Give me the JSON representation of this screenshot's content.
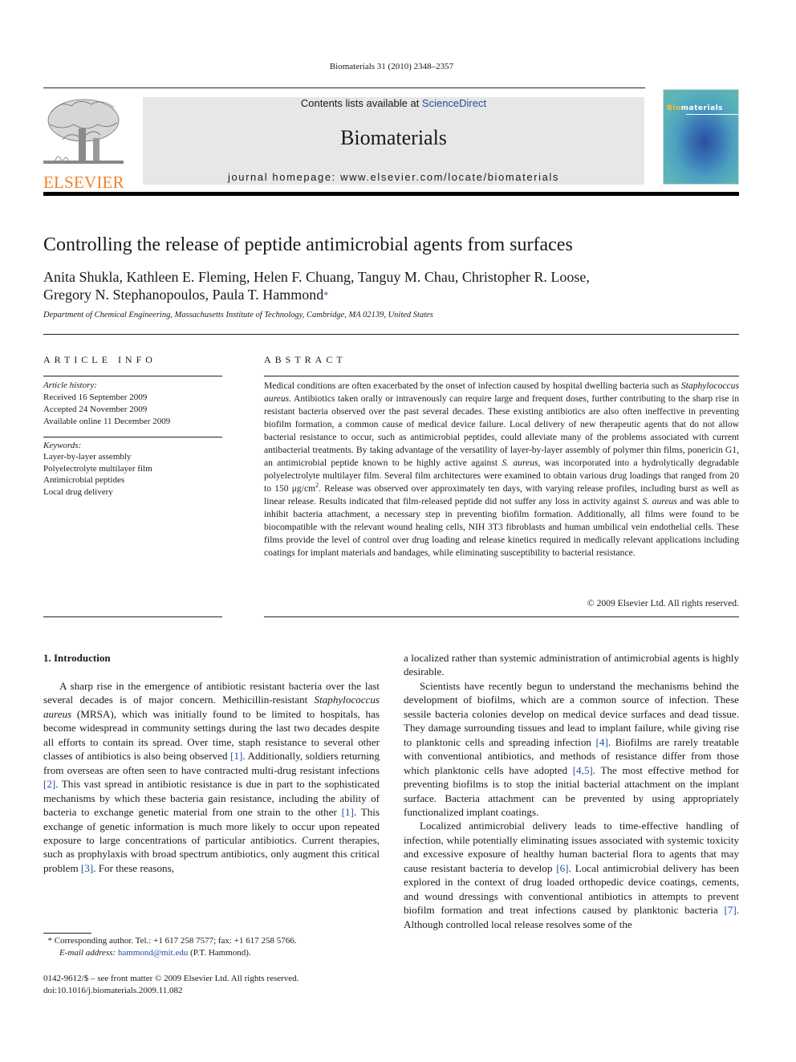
{
  "header": {
    "journal_ref": "Biomaterials 31 (2010) 2348–2357",
    "contents_prefix": "Contents lists available at ",
    "contents_link": "ScienceDirect",
    "journal_name": "Biomaterials",
    "homepage": "journal homepage: www.elsevier.com/locate/biomaterials",
    "publisher_logo_text": "ELSEVIER",
    "cover": {
      "title_highlight": "Bio",
      "title_rest": "materials",
      "highlight_color": "#f2c12e"
    },
    "colors": {
      "publisher_orange": "#f0822a",
      "link_blue": "#1f4ea3",
      "banner_gray": "#e7e7e7"
    }
  },
  "article": {
    "title": "Controlling the release of peptide antimicrobial agents from surfaces",
    "authors_line1": "Anita Shukla, Kathleen E. Fleming, Helen F. Chuang, Tanguy M. Chau, Christopher R. Loose,",
    "authors_line2": "Gregory N. Stephanopoulos, Paula T. Hammond",
    "corresponding_mark": "*",
    "affiliation": "Department of Chemical Engineering, Massachusetts Institute of Technology, Cambridge, MA 02139, United States"
  },
  "article_info": {
    "heading": "ARTICLE INFO",
    "history_label": "Article history:",
    "history": [
      "Received 16 September 2009",
      "Accepted 24 November 2009",
      "Available online 11 December 2009"
    ],
    "keywords_label": "Keywords:",
    "keywords": [
      "Layer-by-layer assembly",
      "Polyelectrolyte multilayer film",
      "Antimicrobial peptides",
      "Local drug delivery"
    ]
  },
  "abstract": {
    "heading": "ABSTRACT",
    "p1": "Medical conditions are often exacerbated by the onset of infection caused by hospital dwelling bacteria such as ",
    "i1": "Staphylococcus aureus",
    "p2": ". Antibiotics taken orally or intravenously can require large and frequent doses, further contributing to the sharp rise in resistant bacteria observed over the past several decades. These existing antibiotics are also often ineffective in preventing biofilm formation, a common cause of medical device failure. Local delivery of new therapeutic agents that do not allow bacterial resistance to occur, such as antimicrobial peptides, could alleviate many of the problems associated with current antibacterial treatments. By taking advantage of the versatility of layer-by-layer assembly of polymer thin films, ponericin G1, an antimicrobial peptide known to be highly active against ",
    "i2": "S. aureus",
    "p3": ", was incorporated into a hydrolytically degradable polyelectrolyte multilayer film. Several film architectures were examined to obtain various drug loadings that ranged from 20 to 150 μg/cm",
    "sup": "2",
    "p4": ". Release was observed over approximately ten days, with varying release profiles, including burst as well as linear release. Results indicated that film-released peptide did not suffer any loss in activity against ",
    "i3": "S. aureus",
    "p5": " and was able to inhibit bacteria attachment, a necessary step in preventing biofilm formation. Additionally, all films were found to be biocompatible with the relevant wound healing cells, NIH 3T3 fibroblasts and human umbilical vein endothelial cells. These films provide the level of control over drug loading and release kinetics required in medically relevant applications including coatings for implant materials and bandages, while eliminating susceptibility to bacterial resistance.",
    "copyright": "© 2009 Elsevier Ltd. All rights reserved."
  },
  "intro": {
    "heading": "1.  Introduction",
    "left": {
      "a": "A sharp rise in the emergence of antibiotic resistant bacteria over the last several decades is of major concern. Methicillin-resistant ",
      "a_it": "Staphylococcus aureus",
      "b": " (MRSA), which was initially found to be limited to hospitals, has become widespread in community settings during the last two decades despite all efforts to contain its spread. Over time, staph resistance to several other classes of antibiotics is also being observed ",
      "r1": "[1]",
      "c": ". Additionally, soldiers returning from overseas are often seen to have contracted multi-drug resistant infections ",
      "r2": "[2]",
      "d": ". This vast spread in antibiotic resistance is due in part to the sophisticated mechanisms by which these bacteria gain resistance, including the ability of bacteria to exchange genetic material from one strain to the other ",
      "r3": "[1]",
      "e": ". This exchange of genetic information is much more likely to occur upon repeated exposure to large concentrations of particular antibiotics. Current therapies, such as prophylaxis with broad spectrum antibiotics, only augment this critical problem ",
      "r4": "[3]",
      "f": ". For these reasons,"
    },
    "right": {
      "cont": "a localized rather than systemic administration of antimicrobial agents is highly desirable.",
      "p2a": "Scientists have recently begun to understand the mechanisms behind the development of biofilms, which are a common source of infection. These sessile bacteria colonies develop on medical device surfaces and dead tissue. They damage surrounding tissues and lead to implant failure, while giving rise to planktonic cells and spreading infection ",
      "r4": "[4]",
      "p2b": ". Biofilms are rarely treatable with conventional antibiotics, and methods of resistance differ from those which planktonic cells have adopted ",
      "r45": "[4,5]",
      "p2c": ". The most effective method for preventing biofilms is to stop the initial bacterial attachment on the implant surface. Bacteria attachment can be prevented by using appropriately functionalized implant coatings.",
      "p3a": "Localized antimicrobial delivery leads to time-effective handling of infection, while potentially eliminating issues associated with systemic toxicity and excessive exposure of healthy human bacterial flora to agents that may cause resistant bacteria to develop ",
      "r6": "[6]",
      "p3b": ". Local antimicrobial delivery has been explored in the context of drug loaded orthopedic device coatings, cements, and wound dressings with conventional antibiotics in attempts to prevent biofilm formation and treat infections caused by planktonic bacteria ",
      "r7": "[7]",
      "p3c": ". Although controlled local release resolves some of the"
    }
  },
  "footnote": {
    "mark": "*",
    "line1": " Corresponding author. Tel.: +1 617 258 7577; fax: +1 617 258 5766.",
    "email_label": "E-mail address: ",
    "email": "hammond@mit.edu",
    "email_suffix": " (P.T. Hammond)."
  },
  "front_matter": {
    "issn_line": "0142-9612/$ – see front matter © 2009 Elsevier Ltd. All rights reserved.",
    "doi": "doi:10.1016/j.biomaterials.2009.11.082"
  }
}
